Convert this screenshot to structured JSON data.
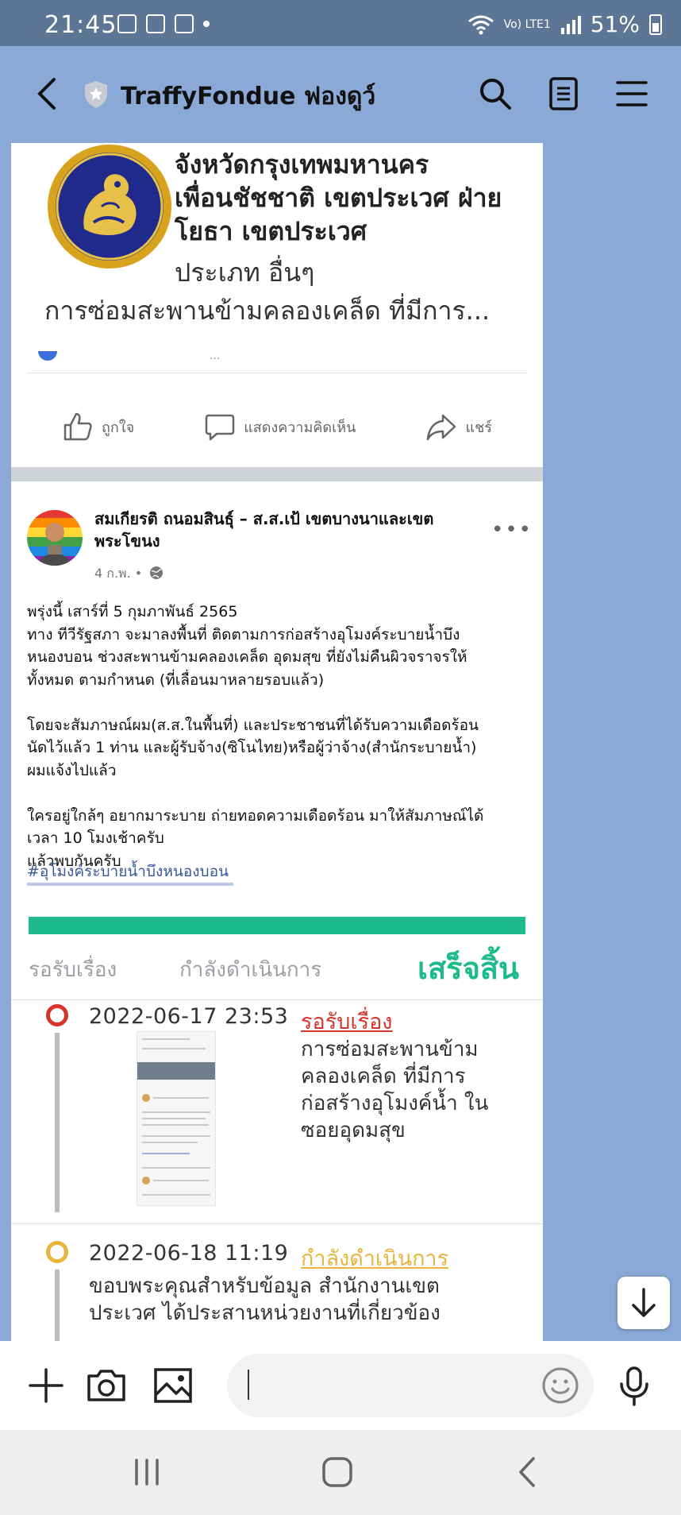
{
  "status_bar": {
    "time": "21:45",
    "network": "Vo) LTE1",
    "battery": "51%"
  },
  "header": {
    "title": "TraffyFondue ฟองดูว์"
  },
  "report": {
    "org_lines": [
      "จังหวัดกรุงเทพมหานคร",
      "เพื่อนชัชชาติ เขตประเวศ ฝ่าย",
      "โยธา เขตประเวศ"
    ],
    "type": "ประเภท อื่นๆ",
    "subject": "การซ่อมสะพานข้ามคลองเคล็ด ที่มีการ..."
  },
  "fb_post": {
    "actions": [
      "ถูกใจ",
      "แสดงความคิดเห็น",
      "แชร์"
    ],
    "poster": "สมเกียรติ ถนอมสินธุ์ – ส.ส.เป้ เขตบางนาและเขตพระโขนง",
    "meta": "4 ก.พ. •",
    "paragraphs": [
      [
        "พรุ่งนี้ เสาร์ที่ 5 กุมภาพันธ์ 2565",
        "ทาง ทีวีรัฐสภา จะมาลงพื้นที่ ติดตามการก่อสร้างอุโมงค์ระบายน้ำบึง",
        "หนองบอน ช่วงสะพานข้ามคลองเคล็ด อุดมสุข ที่ยังไม่คืนผิวจราจรให้",
        "ทั้งหมด ตามกำหนด (ที่เลื่อนมาหลายรอบแล้ว)"
      ],
      [
        "โดยจะสัมภาษณ์ผม(ส.ส.ในพื้นที่) และประชาชนที่ได้รับความเดือดร้อน",
        "นัดไว้แล้ว 1 ท่าน และผู้รับจ้าง(ซิโนไทย)หรือผู้ว่าจ้าง(สำนักระบายน้ำ)",
        "ผมแจ้งไปแล้ว"
      ],
      [
        "ใครอยู่ใกล้ๆ อยากมาระบาย ถ่ายทอดความเดือดร้อน มาให้สัมภาษณ์ได้",
        "เวลา 10 โมงเช้าครับ",
        "แล้วพบกันครับ"
      ]
    ],
    "hashtag": "#อุโมงค์ระบายน้ำบึงหนองบอน"
  },
  "progress": {
    "stages": [
      "รอรับเรื่อง",
      "กำลังดำเนินการ",
      "เสร็จสิ้น"
    ],
    "current_stage": "เสร็จสิ้น",
    "accent": "#1dbb8b"
  },
  "timeline": [
    {
      "datetime": "2022-06-17 23:53",
      "status": "รอรับเรื่อง",
      "status_color": "#d9342b",
      "desc_lines": [
        "การซ่อมสะพานข้าม",
        "คลองเคล็ด ที่มีการ",
        "ก่อสร้างอุโมงค์น้ำ ใน",
        "ซอยอุดมสุข"
      ]
    },
    {
      "datetime": "2022-06-18 11:19",
      "status": "กำลังดำเนินการ",
      "status_color": "#e8b53e",
      "desc_lines": [
        "ขอบพระคุณสำหรับข้อมูล สำนักงานเขต",
        "ประเวศ ได้ประสานหน่วยงานที่เกี่ยวข้อง"
      ]
    }
  ],
  "composer": {
    "placeholder": ""
  }
}
